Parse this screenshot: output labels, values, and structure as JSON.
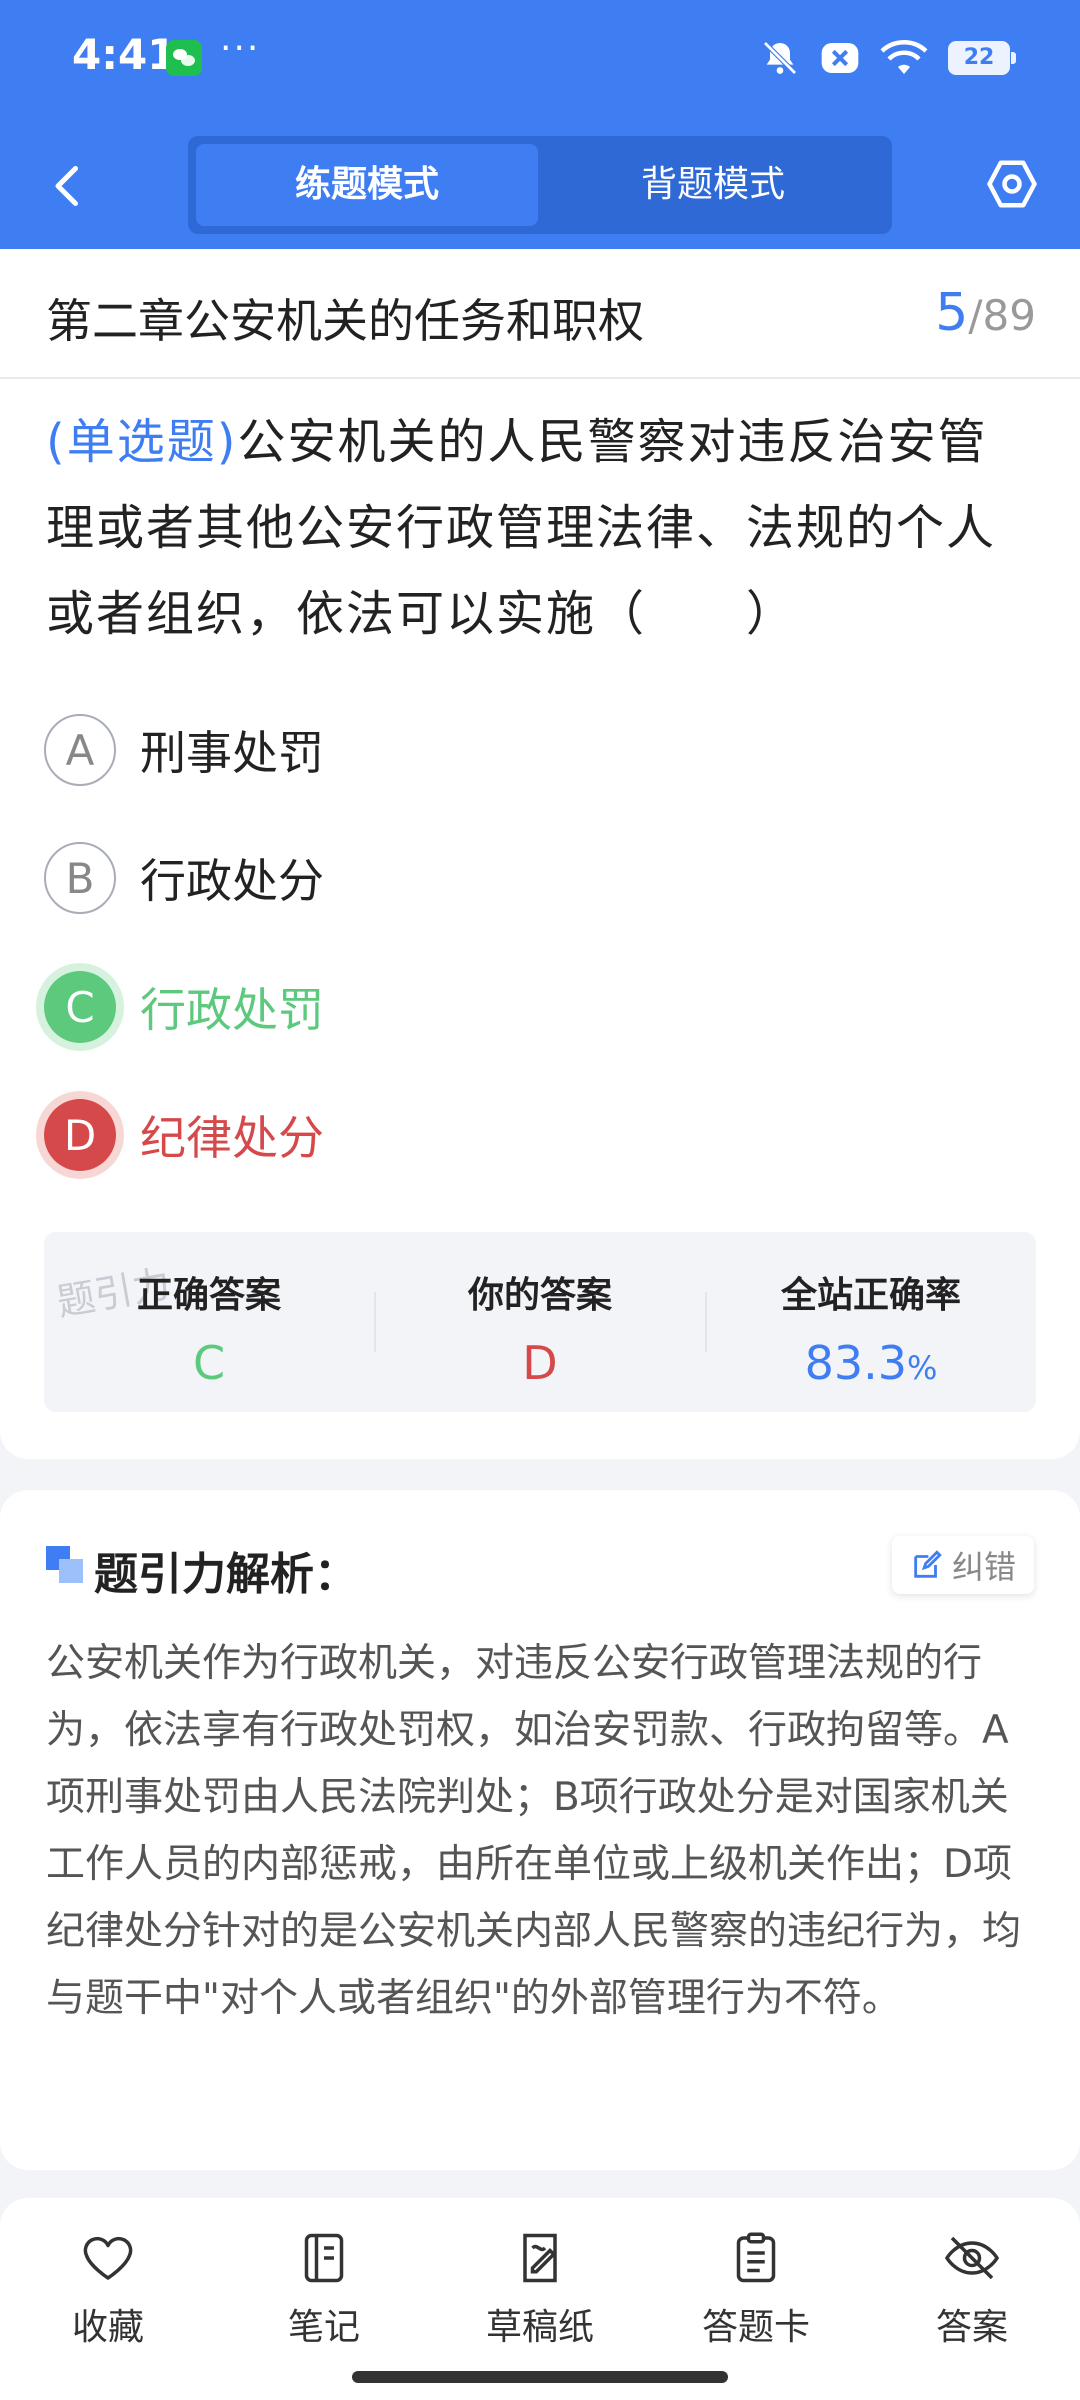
{
  "status_bar": {
    "time": "4:41",
    "more": "···",
    "battery": "22"
  },
  "nav": {
    "tab_practice": "练题模式",
    "tab_memorize": "背题模式"
  },
  "chapter": {
    "title": "第二章公安机关的任务和职权",
    "current": "5",
    "separator": "/",
    "total": "89"
  },
  "question": {
    "type": "(单选题)",
    "text": "公安机关的人民警察对违反治安管理或者其他公安行政管理法律、法规的个人或者组织，依法可以实施（　　）"
  },
  "options": [
    {
      "letter": "A",
      "text": "刑事处罚",
      "state": "normal"
    },
    {
      "letter": "B",
      "text": "行政处分",
      "state": "normal"
    },
    {
      "letter": "C",
      "text": "行政处罚",
      "state": "correct"
    },
    {
      "letter": "D",
      "text": "纪律处分",
      "state": "wrong"
    }
  ],
  "answer_summary": {
    "watermark": "题引力",
    "correct_label": "正确答案",
    "correct_value": "C",
    "yours_label": "你的答案",
    "yours_value": "D",
    "rate_label": "全站正确率",
    "rate_value": "83.3",
    "rate_unit": "%"
  },
  "analysis": {
    "title": "题引力解析：",
    "correct_button": "纠错",
    "body": "公安机关作为行政机关，对违反公安行政管理法规的行为，依法享有行政处罚权，如治安罚款、行政拘留等。A项刑事处罚由人民法院判处；B项行政处分是对国家机关工作人员的内部惩戒，由所在单位或上级机关作出；D项纪律处分针对的是公安机关内部人民警察的违纪行为，均与题干中\"对个人或者组织\"的外部管理行为不符。"
  },
  "bottom_bar": {
    "favorite": "收藏",
    "notes": "笔记",
    "scratch": "草稿纸",
    "answer_card": "答题卡",
    "answer": "答案"
  },
  "colors": {
    "brand": "#3f7ef2",
    "correct": "#5cc97d",
    "wrong": "#d6494a"
  }
}
